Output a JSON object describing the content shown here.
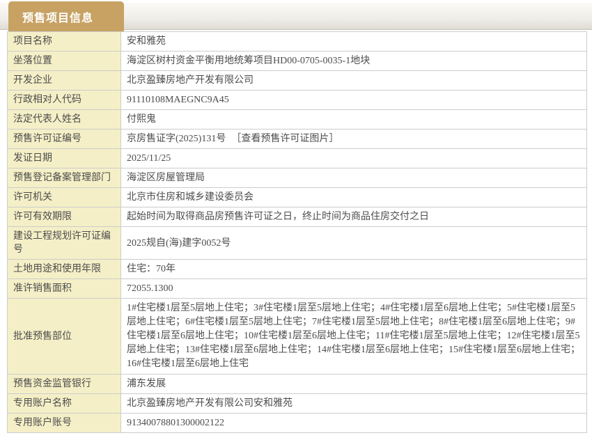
{
  "header": {
    "tab_label": "预售项目信息"
  },
  "colors": {
    "tab_bg": "#c7a263",
    "label_bg": "#f5efc7",
    "border": "#cccccc",
    "text": "#4c4c4c"
  },
  "table": {
    "rows": [
      {
        "label": "项目名称",
        "value": "安和雅苑"
      },
      {
        "label": "坐落位置",
        "value": "海淀区树村资金平衡用地统筹项目HD00-0705-0035-1地块"
      },
      {
        "label": "开发企业",
        "value": "北京盈臻房地产开发有限公司"
      },
      {
        "label": "行政相对人代码",
        "value": "91110108MAEGNC9A45"
      },
      {
        "label": "法定代表人姓名",
        "value": "付熙鬼"
      },
      {
        "label": "预售许可证编号",
        "value": "京房售证字(2025)131号",
        "link": "［查看预售许可证图片］"
      },
      {
        "label": "发证日期",
        "value": "2025/11/25"
      },
      {
        "label": "预售登记备案管理部门",
        "value": "海淀区房屋管理局"
      },
      {
        "label": "许可机关",
        "value": "北京市住房和城乡建设委员会"
      },
      {
        "label": "许可有效期限",
        "value": "起始时间为取得商品房预售许可证之日，终止时间为商品住房交付之日"
      },
      {
        "label": "建设工程规划许可证编号",
        "value": "2025规自(海)建字0052号"
      },
      {
        "label": "土地用途和使用年限",
        "value": "住宅：70年"
      },
      {
        "label": "准许销售面积",
        "value": "72055.1300"
      },
      {
        "label": "批准预售部位",
        "value": "1#住宅楼1层至5层地上住宅；3#住宅楼1层至5层地上住宅；4#住宅楼1层至6层地上住宅；5#住宅楼1层至5层地上住宅；6#住宅楼1层至5层地上住宅；7#住宅楼1层至5层地上住宅；8#住宅楼1层至6层地上住宅；9#住宅楼1层至6层地上住宅；10#住宅楼1层至6层地上住宅；11#住宅楼1层至5层地上住宅；12#住宅楼1层至5层地上住宅；13#住宅楼1层至6层地上住宅；14#住宅楼1层至6层地上住宅；15#住宅楼1层至6层地上住宅；16#住宅楼1层至6层地上住宅"
      },
      {
        "label": "预售资金监管银行",
        "value": "浦东发展"
      },
      {
        "label": "专用账户名称",
        "value": "北京盈臻房地产开发有限公司安和雅苑"
      },
      {
        "label": "专用账户账号",
        "value": "91340078801300002122"
      }
    ]
  }
}
